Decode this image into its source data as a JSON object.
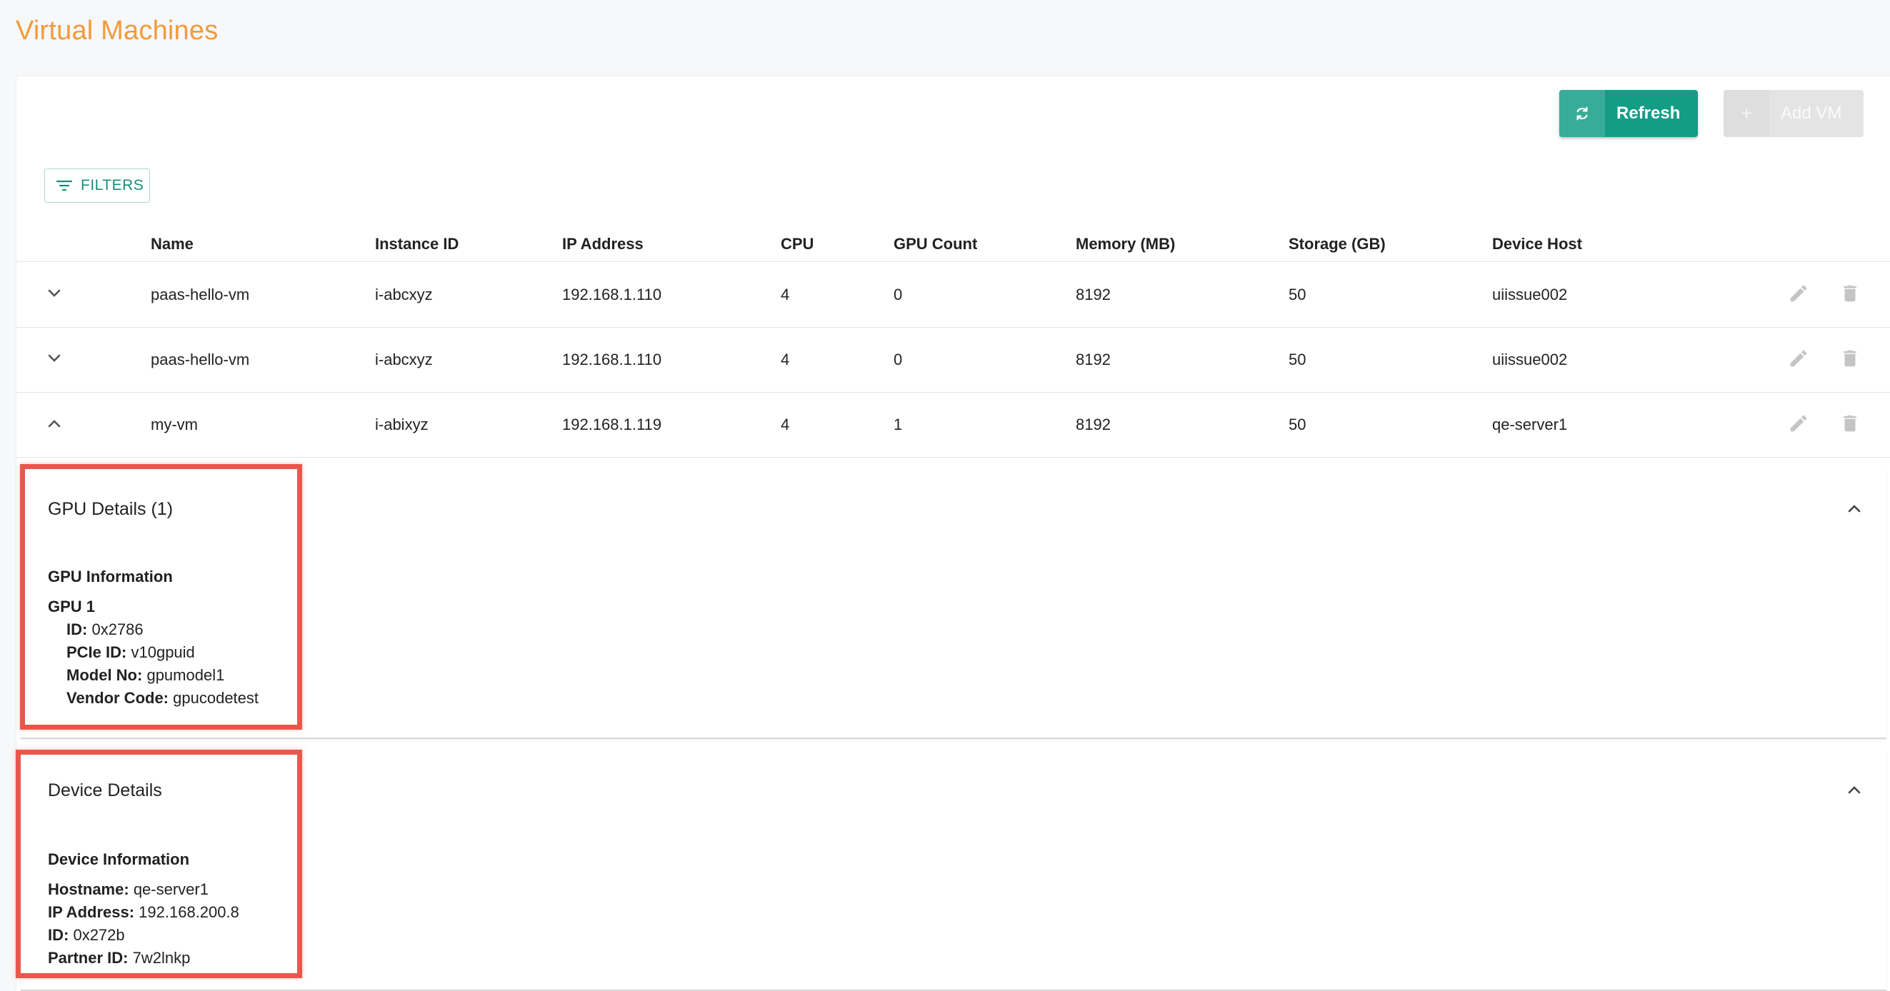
{
  "page": {
    "title": "Virtual Machines"
  },
  "toolbar": {
    "refresh_label": "Refresh",
    "refresh_icon": "refresh-icon",
    "add_label": "Add VM",
    "add_icon": "plus-icon",
    "filters_label": "FILTERS",
    "filters_icon": "filter-list-icon"
  },
  "table": {
    "columns": [
      "Name",
      "Instance ID",
      "IP Address",
      "CPU",
      "GPU Count",
      "Memory (MB)",
      "Storage (GB)",
      "Device Host"
    ],
    "rows": [
      {
        "name": "paas-hello-vm",
        "instance_id": "i-abcxyz",
        "ip": "192.168.1.110",
        "cpu": "4",
        "gpu_count": "0",
        "memory": "8192",
        "storage": "50",
        "host": "uiissue002",
        "expanded": false
      },
      {
        "name": "paas-hello-vm",
        "instance_id": "i-abcxyz",
        "ip": "192.168.1.110",
        "cpu": "4",
        "gpu_count": "0",
        "memory": "8192",
        "storage": "50",
        "host": "uiissue002",
        "expanded": false
      },
      {
        "name": "my-vm",
        "instance_id": "i-abixyz",
        "ip": "192.168.1.119",
        "cpu": "4",
        "gpu_count": "1",
        "memory": "8192",
        "storage": "50",
        "host": "qe-server1",
        "expanded": true
      }
    ]
  },
  "gpu_panel": {
    "title": "GPU Details (1)",
    "section": "GPU Information",
    "gpu_label": "GPU 1",
    "fields": [
      {
        "key": "ID:",
        "value": "0x2786"
      },
      {
        "key": "PCIe ID:",
        "value": "v10gpuid"
      },
      {
        "key": "Model No:",
        "value": "gpumodel1"
      },
      {
        "key": "Vendor Code:",
        "value": "gpucodetest"
      }
    ]
  },
  "device_panel": {
    "title": "Device Details",
    "section": "Device Information",
    "fields": [
      {
        "key": "Hostname:",
        "value": "qe-server1"
      },
      {
        "key": "IP Address:",
        "value": "192.168.200.8"
      },
      {
        "key": "ID:",
        "value": "0x272b"
      },
      {
        "key": "Partner ID:",
        "value": "7w2lnkp"
      }
    ]
  },
  "colors": {
    "title": "#f39a3a",
    "primary": "#149d86",
    "highlight": "#e9574c"
  }
}
